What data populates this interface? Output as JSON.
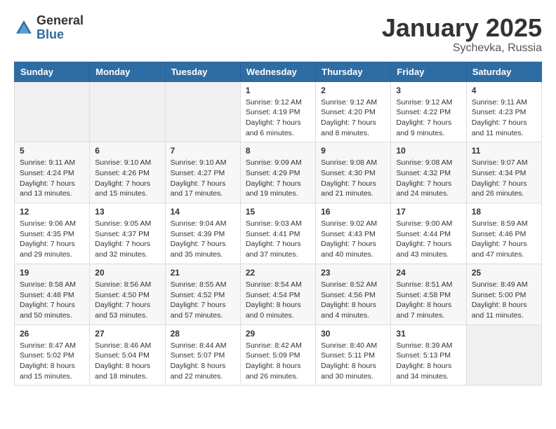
{
  "header": {
    "logo_general": "General",
    "logo_blue": "Blue",
    "month": "January 2025",
    "location": "Sychevka, Russia"
  },
  "weekdays": [
    "Sunday",
    "Monday",
    "Tuesday",
    "Wednesday",
    "Thursday",
    "Friday",
    "Saturday"
  ],
  "weeks": [
    [
      {
        "day": "",
        "content": ""
      },
      {
        "day": "",
        "content": ""
      },
      {
        "day": "",
        "content": ""
      },
      {
        "day": "1",
        "content": "Sunrise: 9:12 AM\nSunset: 4:19 PM\nDaylight: 7 hours and 6 minutes."
      },
      {
        "day": "2",
        "content": "Sunrise: 9:12 AM\nSunset: 4:20 PM\nDaylight: 7 hours and 8 minutes."
      },
      {
        "day": "3",
        "content": "Sunrise: 9:12 AM\nSunset: 4:22 PM\nDaylight: 7 hours and 9 minutes."
      },
      {
        "day": "4",
        "content": "Sunrise: 9:11 AM\nSunset: 4:23 PM\nDaylight: 7 hours and 11 minutes."
      }
    ],
    [
      {
        "day": "5",
        "content": "Sunrise: 9:11 AM\nSunset: 4:24 PM\nDaylight: 7 hours and 13 minutes."
      },
      {
        "day": "6",
        "content": "Sunrise: 9:10 AM\nSunset: 4:26 PM\nDaylight: 7 hours and 15 minutes."
      },
      {
        "day": "7",
        "content": "Sunrise: 9:10 AM\nSunset: 4:27 PM\nDaylight: 7 hours and 17 minutes."
      },
      {
        "day": "8",
        "content": "Sunrise: 9:09 AM\nSunset: 4:29 PM\nDaylight: 7 hours and 19 minutes."
      },
      {
        "day": "9",
        "content": "Sunrise: 9:08 AM\nSunset: 4:30 PM\nDaylight: 7 hours and 21 minutes."
      },
      {
        "day": "10",
        "content": "Sunrise: 9:08 AM\nSunset: 4:32 PM\nDaylight: 7 hours and 24 minutes."
      },
      {
        "day": "11",
        "content": "Sunrise: 9:07 AM\nSunset: 4:34 PM\nDaylight: 7 hours and 26 minutes."
      }
    ],
    [
      {
        "day": "12",
        "content": "Sunrise: 9:06 AM\nSunset: 4:35 PM\nDaylight: 7 hours and 29 minutes."
      },
      {
        "day": "13",
        "content": "Sunrise: 9:05 AM\nSunset: 4:37 PM\nDaylight: 7 hours and 32 minutes."
      },
      {
        "day": "14",
        "content": "Sunrise: 9:04 AM\nSunset: 4:39 PM\nDaylight: 7 hours and 35 minutes."
      },
      {
        "day": "15",
        "content": "Sunrise: 9:03 AM\nSunset: 4:41 PM\nDaylight: 7 hours and 37 minutes."
      },
      {
        "day": "16",
        "content": "Sunrise: 9:02 AM\nSunset: 4:43 PM\nDaylight: 7 hours and 40 minutes."
      },
      {
        "day": "17",
        "content": "Sunrise: 9:00 AM\nSunset: 4:44 PM\nDaylight: 7 hours and 43 minutes."
      },
      {
        "day": "18",
        "content": "Sunrise: 8:59 AM\nSunset: 4:46 PM\nDaylight: 7 hours and 47 minutes."
      }
    ],
    [
      {
        "day": "19",
        "content": "Sunrise: 8:58 AM\nSunset: 4:48 PM\nDaylight: 7 hours and 50 minutes."
      },
      {
        "day": "20",
        "content": "Sunrise: 8:56 AM\nSunset: 4:50 PM\nDaylight: 7 hours and 53 minutes."
      },
      {
        "day": "21",
        "content": "Sunrise: 8:55 AM\nSunset: 4:52 PM\nDaylight: 7 hours and 57 minutes."
      },
      {
        "day": "22",
        "content": "Sunrise: 8:54 AM\nSunset: 4:54 PM\nDaylight: 8 hours and 0 minutes."
      },
      {
        "day": "23",
        "content": "Sunrise: 8:52 AM\nSunset: 4:56 PM\nDaylight: 8 hours and 4 minutes."
      },
      {
        "day": "24",
        "content": "Sunrise: 8:51 AM\nSunset: 4:58 PM\nDaylight: 8 hours and 7 minutes."
      },
      {
        "day": "25",
        "content": "Sunrise: 8:49 AM\nSunset: 5:00 PM\nDaylight: 8 hours and 11 minutes."
      }
    ],
    [
      {
        "day": "26",
        "content": "Sunrise: 8:47 AM\nSunset: 5:02 PM\nDaylight: 8 hours and 15 minutes."
      },
      {
        "day": "27",
        "content": "Sunrise: 8:46 AM\nSunset: 5:04 PM\nDaylight: 8 hours and 18 minutes."
      },
      {
        "day": "28",
        "content": "Sunrise: 8:44 AM\nSunset: 5:07 PM\nDaylight: 8 hours and 22 minutes."
      },
      {
        "day": "29",
        "content": "Sunrise: 8:42 AM\nSunset: 5:09 PM\nDaylight: 8 hours and 26 minutes."
      },
      {
        "day": "30",
        "content": "Sunrise: 8:40 AM\nSunset: 5:11 PM\nDaylight: 8 hours and 30 minutes."
      },
      {
        "day": "31",
        "content": "Sunrise: 8:39 AM\nSunset: 5:13 PM\nDaylight: 8 hours and 34 minutes."
      },
      {
        "day": "",
        "content": ""
      }
    ]
  ]
}
